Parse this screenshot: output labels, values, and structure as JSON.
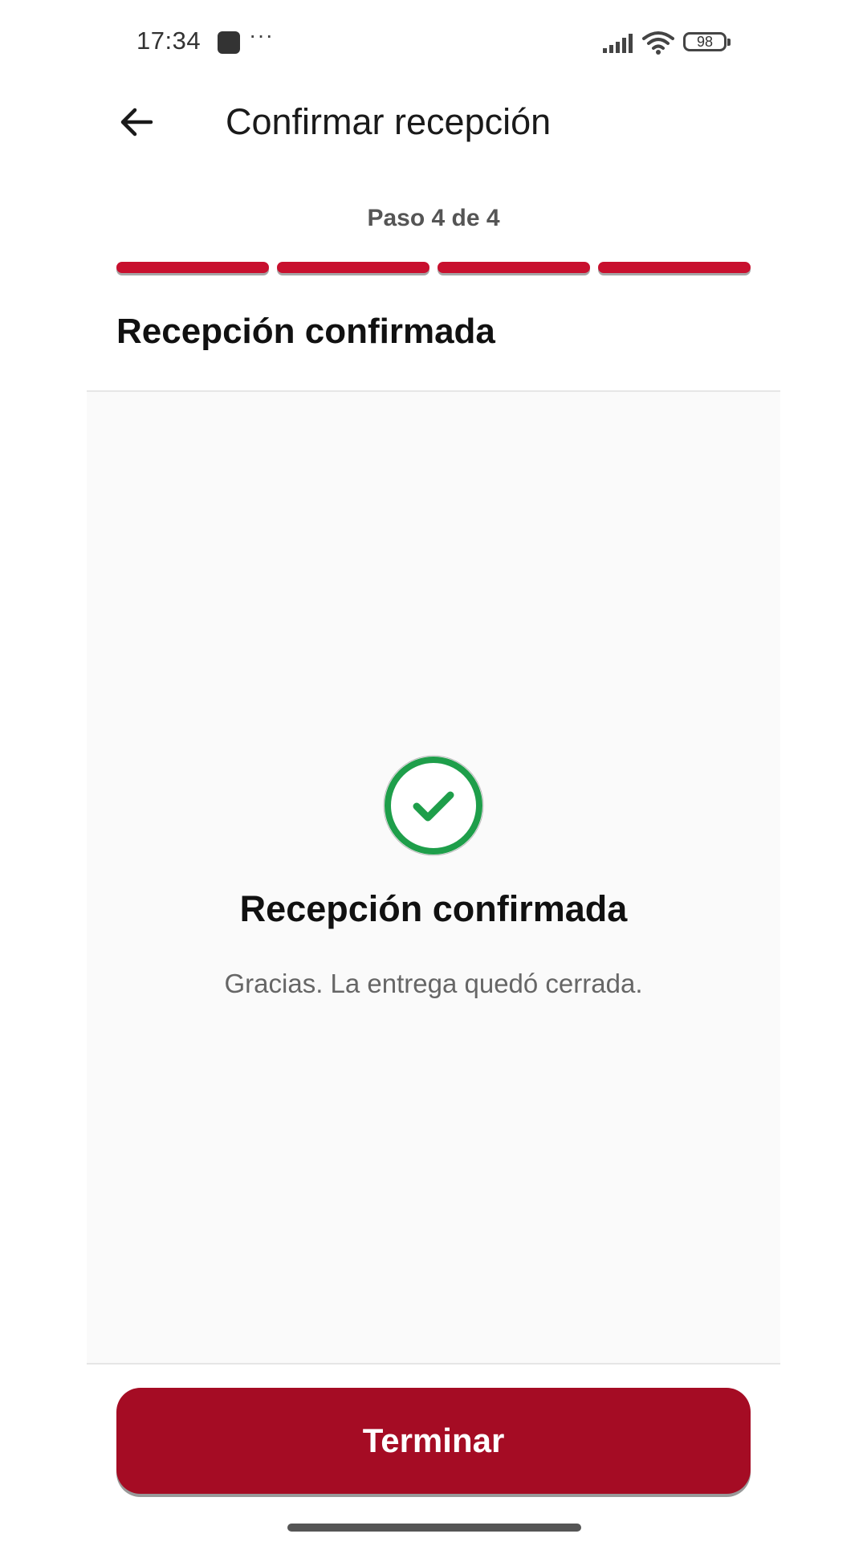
{
  "status_bar": {
    "time": "17:34",
    "dots": "···",
    "battery": "98",
    "icons": [
      "app-notification-icon",
      "signal-icon",
      "wifi-icon",
      "battery-icon"
    ]
  },
  "header": {
    "title": "Confirmar recepción",
    "back_icon": "arrow-left-icon"
  },
  "progress": {
    "label": "Paso 4 de 4",
    "current_step": 4,
    "total_steps": 4,
    "color": "#c8102e"
  },
  "section": {
    "title": "Recepción confirmada"
  },
  "success": {
    "icon": "check-circle-icon",
    "icon_color": "#1e9e4a",
    "title": "Recepción confirmada",
    "message": "Gracias. La entrega quedó cerrada."
  },
  "footer": {
    "button_label": "Terminar",
    "button_color": "#a50c24"
  }
}
